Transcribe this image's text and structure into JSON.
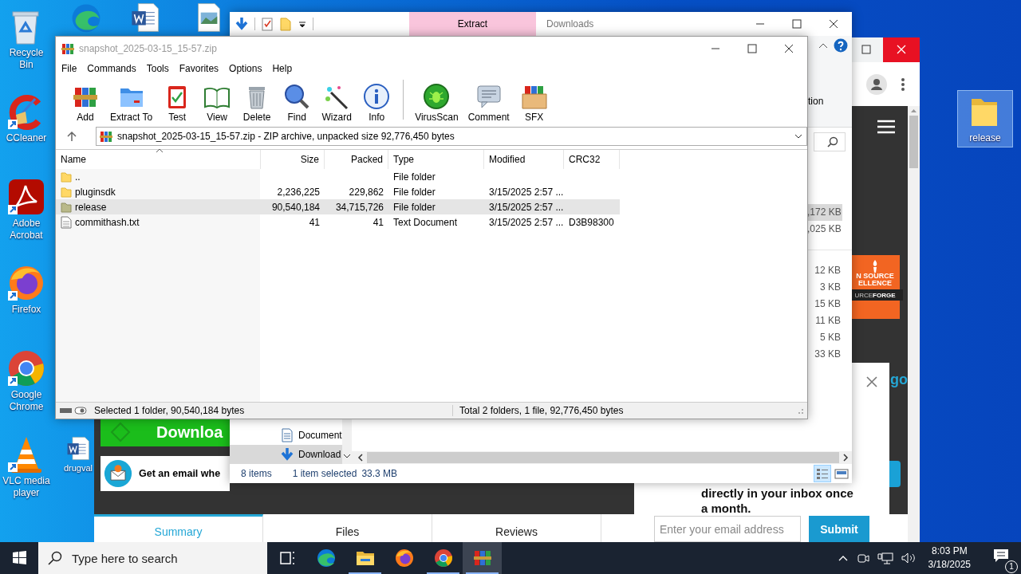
{
  "desktop": {
    "icons": [
      {
        "kind": "recycle_bin",
        "label": "Recycle Bin",
        "shortcut": false,
        "selected": false
      },
      {
        "kind": "ccleaner",
        "label": "CCleaner",
        "shortcut": true,
        "selected": false
      },
      {
        "kind": "acrobat",
        "label": "Adobe Acrobat",
        "shortcut": true,
        "selected": false
      },
      {
        "kind": "firefox",
        "label": "Firefox",
        "shortcut": true,
        "selected": false
      },
      {
        "kind": "chrome",
        "label": "Google Chrome",
        "shortcut": true,
        "selected": false
      },
      {
        "kind": "vlc",
        "label": "VLC media player",
        "shortcut": true,
        "selected": false
      },
      {
        "kind": "edge",
        "shortcut": false,
        "selected": false
      },
      {
        "kind": "word",
        "shortcut": false,
        "selected": false
      },
      {
        "kind": "image",
        "shortcut": false,
        "selected": false
      },
      {
        "kind": "word",
        "label": "drugval",
        "shortcut": false,
        "selected": false
      },
      {
        "kind": "folder",
        "label": "release",
        "shortcut": false,
        "selected": true
      }
    ]
  },
  "browser": {
    "download_button": "Downloa",
    "email_banner": "Get an email whe",
    "tabs": [
      {
        "label": "Summary",
        "selected": true
      },
      {
        "label": "Files",
        "selected": false
      },
      {
        "label": "Reviews",
        "selected": false
      }
    ],
    "badge": {
      "lines": [
        "N SOURCE",
        "ELLENCE"
      ],
      "footer": [
        "URCE",
        "FORGE"
      ]
    },
    "side_text": "go",
    "popup": {
      "lines": [
        "directly in your inbox once",
        "a month."
      ],
      "email_placeholder": "Enter your email address",
      "submit": "Submit"
    }
  },
  "explorer": {
    "title": "Downloads",
    "context_tab": "Extract",
    "ribbon_text": "tion",
    "size_groups": [
      [
        {
          "size": ",172 KB",
          "selected": true
        },
        {
          "size": ",025 KB",
          "selected": false
        }
      ],
      [
        {
          "size": "12 KB",
          "selected": false
        },
        {
          "size": "3 KB",
          "selected": false
        },
        {
          "size": "15 KB",
          "selected": false
        },
        {
          "size": "11 KB",
          "selected": false
        },
        {
          "size": "5 KB",
          "selected": false
        },
        {
          "size": "33 KB",
          "selected": false
        }
      ]
    ],
    "nav_items": [
      {
        "kind": "document",
        "label": "Document",
        "selected": false
      },
      {
        "kind": "download",
        "label": "Download",
        "selected": true
      }
    ],
    "status": {
      "count": "8 items",
      "selection": "1 item selected",
      "size": "33.3 MB"
    },
    "views": [
      {
        "kind": "details",
        "selected": true
      },
      {
        "kind": "thumbnails",
        "selected": false
      }
    ]
  },
  "winrar": {
    "title": "snapshot_2025-03-15_15-57.zip",
    "menu": [
      "File",
      "Commands",
      "Tools",
      "Favorites",
      "Options",
      "Help"
    ],
    "toolbar": [
      {
        "kind": "add",
        "label": "Add"
      },
      {
        "kind": "extract",
        "label": "Extract To"
      },
      {
        "kind": "test",
        "label": "Test"
      },
      {
        "kind": "view",
        "label": "View"
      },
      {
        "kind": "delete",
        "label": "Delete"
      },
      {
        "kind": "find",
        "label": "Find"
      },
      {
        "kind": "wizard",
        "label": "Wizard"
      },
      {
        "kind": "info",
        "label": "Info"
      },
      {
        "kind": "virusscan",
        "label": "VirusScan"
      },
      {
        "kind": "comment",
        "label": "Comment"
      },
      {
        "kind": "sfx",
        "label": "SFX"
      }
    ],
    "address": "snapshot_2025-03-15_15-57.zip - ZIP archive, unpacked size 92,776,450 bytes",
    "columns": [
      "Name",
      "Size",
      "Packed",
      "Type",
      "Modified",
      "CRC32"
    ],
    "rows": [
      {
        "kind": "parent",
        "name": "..",
        "type": "File folder",
        "selected": false
      },
      {
        "kind": "folder",
        "name": "pluginsdk",
        "size": "2,236,225",
        "packed": "229,862",
        "type": "File folder",
        "modified": "3/15/2025 2:57 ...",
        "selected": false
      },
      {
        "kind": "folder",
        "name": "release",
        "size": "90,540,184",
        "packed": "34,715,726",
        "type": "File folder",
        "modified": "3/15/2025 2:57 ...",
        "selected": true
      },
      {
        "kind": "file",
        "name": "commithash.txt",
        "size": "41",
        "packed": "41",
        "type": "Text Document",
        "modified": "3/15/2025 2:57 ...",
        "crc32": "D3B98300",
        "selected": false
      }
    ],
    "status": {
      "selection": "Selected 1 folder, 90,540,184 bytes",
      "total": "Total 2 folders, 1 file, 92,776,450 bytes"
    }
  },
  "taskbar": {
    "search_placeholder": "Type here to search",
    "apps": [
      {
        "kind": "task_view",
        "running": false,
        "active": false
      },
      {
        "kind": "edge",
        "running": false,
        "active": false
      },
      {
        "kind": "explorer",
        "running": true,
        "active": false
      },
      {
        "kind": "firefox",
        "running": false,
        "active": false
      },
      {
        "kind": "chrome",
        "running": true,
        "active": false
      },
      {
        "kind": "winrar",
        "running": true,
        "active": true
      }
    ],
    "time": "8:03 PM",
    "date": "3/18/2025",
    "notification_count": "1"
  }
}
